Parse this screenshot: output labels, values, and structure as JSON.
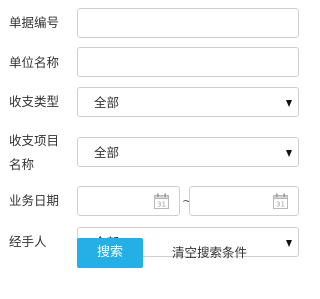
{
  "form": {
    "doc_number": {
      "label": "单据编号",
      "value": ""
    },
    "unit_name": {
      "label": "单位名称",
      "value": ""
    },
    "category": {
      "label": "收支类型",
      "selected": "全部"
    },
    "item_name": {
      "label_line1": "收支项目",
      "label_line2": "名称",
      "selected": "全部"
    },
    "business_date": {
      "label": "业务日期",
      "separator": "~",
      "calendar_day": "31",
      "start_value": "",
      "end_value": ""
    },
    "handler": {
      "label": "经手人",
      "selected": "全部"
    }
  },
  "actions": {
    "search_label": "搜索",
    "clear_label": "清空搜索条件"
  },
  "colors": {
    "primary_button": "#24b0e6",
    "field_border": "#cfcfcf",
    "text": "#333333"
  },
  "icons": {
    "calendar": "calendar-icon",
    "dropdown": "caret-down-icon"
  }
}
